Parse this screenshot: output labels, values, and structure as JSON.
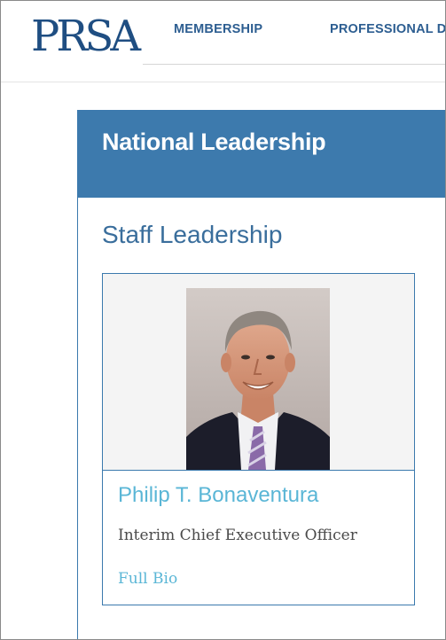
{
  "header": {
    "logo_text": "PRSA",
    "nav": [
      {
        "label": "MEMBERSHIP"
      },
      {
        "label": "PROFESSIONAL D"
      }
    ]
  },
  "main": {
    "panel_title": "National Leadership",
    "section_title": "Staff Leadership",
    "profile": {
      "name": "Philip T. Bonaventura",
      "role": "Interim Chief Executive Officer",
      "link_label": "Full Bio",
      "photo": "headshot-photo"
    }
  },
  "colors": {
    "brand_blue": "#3d7aad",
    "logo_blue": "#1f4e82",
    "nav_blue": "#2d5e91",
    "link_cyan": "#5ab6d6"
  }
}
